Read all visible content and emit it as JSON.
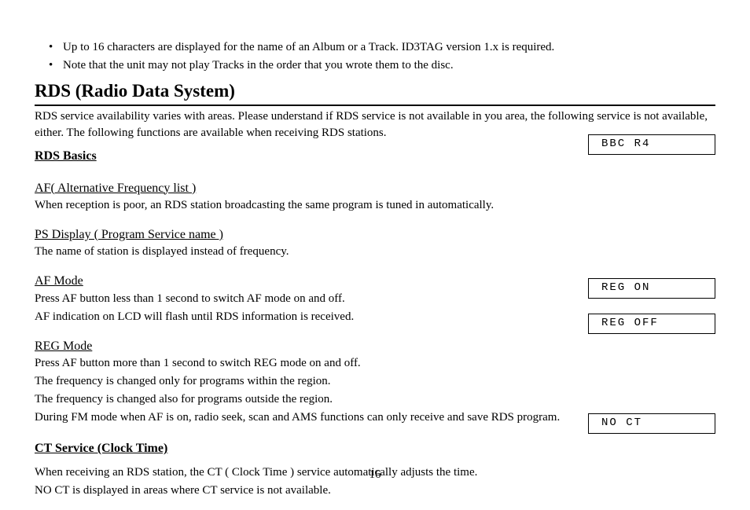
{
  "bullets": [
    "Up to 16 characters are displayed for the name of an Album or a Track. ID3TAG version 1.x is required.",
    "Note that the unit may not play Tracks in the order that you wrote them to the disc."
  ],
  "title": "RDS (Radio Data System)",
  "intro": "RDS service availability varies with areas. Please understand if RDS service is not available in you area, the following service is not available, either. The following functions are available when receiving RDS stations.",
  "rds_basics_heading": "RDS Basics",
  "af_list": {
    "title": "AF( Alternative Frequency list )",
    "body": "When reception is poor, an RDS station broadcasting the same program is tuned in automatically."
  },
  "ps_display": {
    "title": "PS Display ( Program Service name )",
    "body": "The name of station is displayed instead of frequency."
  },
  "af_mode": {
    "title": "AF Mode",
    "line1": "Press AF button less than 1 second to switch AF mode on and off.",
    "line2": "AF indication on LCD will flash until RDS information is received."
  },
  "reg_mode": {
    "title": "REG Mode ",
    "line1": "Press AF button more than 1 second to switch REG mode on and off.",
    "line2": "The frequency is changed only for programs within the region.",
    "line3": "The frequency is changed also for programs outside the region.",
    "line4": "During FM mode when AF is on, radio seek, scan and AMS functions can only receive and save RDS program."
  },
  "ct_service": {
    "heading": "CT Service (Clock Time)",
    "line1": "When receiving an RDS station, the CT ( Clock Time ) service automatically adjusts the time.",
    "line2": "NO CT is displayed in areas where CT service is not available."
  },
  "lcd": {
    "bbc": "BBC R4",
    "reg_on": "REG  ON",
    "reg_off": "REG OFF",
    "no_ct": "NO CT"
  },
  "page_number": "16"
}
